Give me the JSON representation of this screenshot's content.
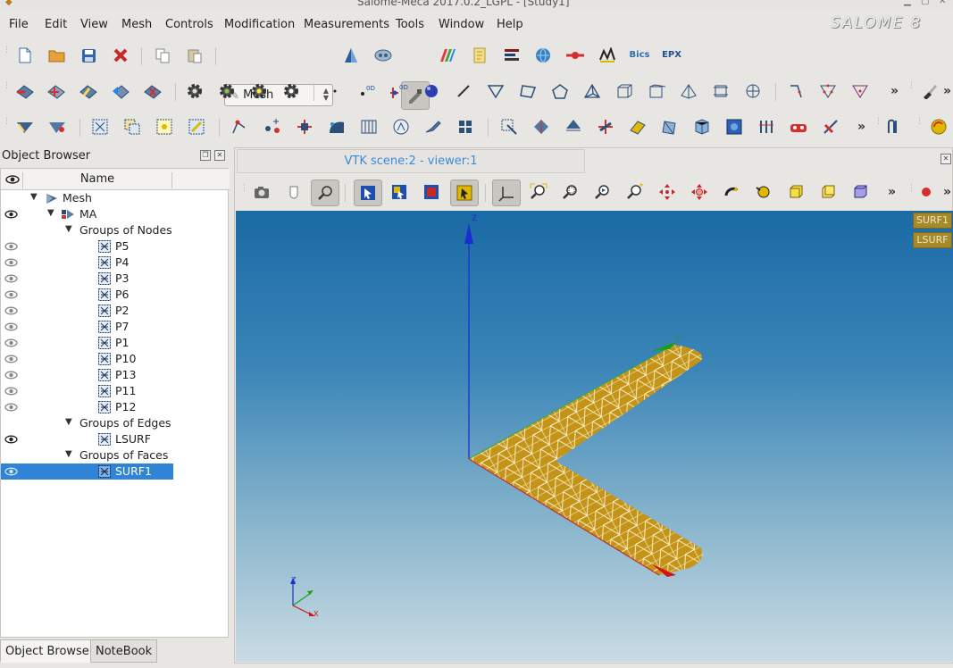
{
  "window": {
    "title": "Salome-Meca 2017.0.2_LGPL - [Study1]"
  },
  "brand": {
    "text": "SALOME 8"
  },
  "menu": {
    "items": [
      "File",
      "Edit",
      "View",
      "Mesh",
      "Controls",
      "Modification",
      "Measurements",
      "Tools",
      "Window",
      "Help"
    ]
  },
  "toolbar": {
    "module_combo_value": "Mesh",
    "bics_label": "Bics",
    "epx_label": "EPX"
  },
  "object_browser": {
    "title": "Object Browser",
    "column_name": "Name",
    "tree": [
      {
        "label": "Mesh",
        "kind": "component"
      },
      {
        "label": "MA",
        "kind": "mesh"
      },
      {
        "label": "Groups of Nodes",
        "kind": "folder"
      },
      {
        "label": "P5",
        "kind": "group"
      },
      {
        "label": "P4",
        "kind": "group"
      },
      {
        "label": "P3",
        "kind": "group"
      },
      {
        "label": "P6",
        "kind": "group"
      },
      {
        "label": "P2",
        "kind": "group"
      },
      {
        "label": "P7",
        "kind": "group"
      },
      {
        "label": "P1",
        "kind": "group"
      },
      {
        "label": "P10",
        "kind": "group"
      },
      {
        "label": "P13",
        "kind": "group"
      },
      {
        "label": "P11",
        "kind": "group"
      },
      {
        "label": "P12",
        "kind": "group"
      },
      {
        "label": "Groups of Edges",
        "kind": "folder"
      },
      {
        "label": "LSURF",
        "kind": "group"
      },
      {
        "label": "Groups of Faces",
        "kind": "folder"
      },
      {
        "label": "SURF1",
        "kind": "group",
        "selected": true
      }
    ]
  },
  "bottom_tabs": [
    "Object Browser",
    "NoteBook"
  ],
  "viewer": {
    "tab_label": "VTK scene:2 - viewer:1",
    "legend": [
      "SURF1",
      "LSURF"
    ],
    "axis_labels": {
      "z": "Z",
      "y": "Y",
      "x": "X"
    }
  },
  "colors": {
    "selection": "#2f84d6",
    "mesh_face": "#c49418",
    "legend_bg": "#a58a2c",
    "viewer_top": "#1a6aa5",
    "viewer_bottom": "#c9dbe4"
  }
}
